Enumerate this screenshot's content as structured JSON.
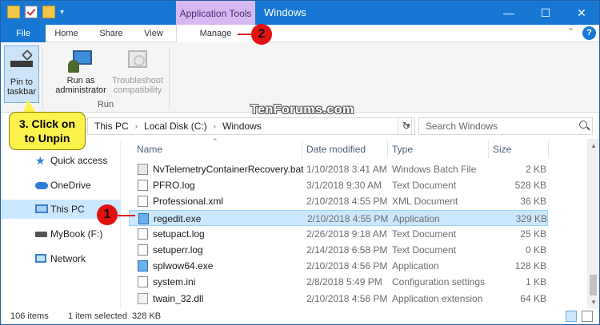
{
  "titlebar": {
    "context_tab": "Application Tools",
    "window_title": "Windows",
    "minimize": "—",
    "maximize": "☐",
    "close": "✕"
  },
  "ribbon_tabs": {
    "file": "File",
    "home": "Home",
    "share": "Share",
    "view": "View",
    "manage": "Manage"
  },
  "ribbon": {
    "pin_label_1": "Pin to",
    "pin_label_2": "taskbar",
    "admin_label_1": "Run as",
    "admin_label_2": "administrator",
    "trouble_label_1": "Troubleshoot",
    "trouble_label_2": "compatibility",
    "group_label": "Run"
  },
  "address": {
    "crumbs": [
      "This PC",
      "Local Disk (C:)",
      "Windows"
    ],
    "search_placeholder": "Search Windows"
  },
  "nav": [
    {
      "label": "Quick access",
      "icon": "star-icon"
    },
    {
      "label": "OneDrive",
      "icon": "cloud-icon"
    },
    {
      "label": "This PC",
      "icon": "computer-icon",
      "selected": true
    },
    {
      "label": "MyBook (F:)",
      "icon": "drive-icon"
    },
    {
      "label": "Network",
      "icon": "network-icon"
    }
  ],
  "columns": {
    "name": "Name",
    "date": "Date modified",
    "type": "Type",
    "size": "Size"
  },
  "files": [
    {
      "name": "NvTelemetryContainerRecovery.bat",
      "date": "1/10/2018 3:41 AM",
      "type": "Windows Batch File",
      "size": "2 KB",
      "icon": "bat"
    },
    {
      "name": "PFRO.log",
      "date": "3/1/2018 9:30 AM",
      "type": "Text Document",
      "size": "528 KB",
      "icon": "txt"
    },
    {
      "name": "Professional.xml",
      "date": "2/10/2018 4:55 PM",
      "type": "XML Document",
      "size": "36 KB",
      "icon": "txt"
    },
    {
      "name": "regedit.exe",
      "date": "2/10/2018 4:55 PM",
      "type": "Application",
      "size": "329 KB",
      "icon": "exe",
      "selected": true
    },
    {
      "name": "setupact.log",
      "date": "2/26/2018 9:18 AM",
      "type": "Text Document",
      "size": "25 KB",
      "icon": "txt"
    },
    {
      "name": "setuperr.log",
      "date": "2/14/2018 6:58 PM",
      "type": "Text Document",
      "size": "0 KB",
      "icon": "txt"
    },
    {
      "name": "splwow64.exe",
      "date": "2/10/2018 4:56 PM",
      "type": "Application",
      "size": "128 KB",
      "icon": "exe"
    },
    {
      "name": "system.ini",
      "date": "2/8/2018 5:49 PM",
      "type": "Configuration settings",
      "size": "1 KB",
      "icon": "txt"
    },
    {
      "name": "twain_32.dll",
      "date": "2/10/2018 4:56 PM",
      "type": "Application extension",
      "size": "64 KB",
      "icon": "dll"
    }
  ],
  "status": {
    "item_count": "106 items",
    "selection": "1 item selected",
    "selection_size": "328 KB"
  },
  "annotations": {
    "badge_1": "1",
    "badge_2": "2",
    "callout_line_1": "3. Click on",
    "callout_line_2": "to Unpin",
    "watermark": "TenForums.com"
  },
  "colors": {
    "accent": "#1778d4",
    "context_tab": "#d8b8f0",
    "selection": "#cce8ff",
    "badge": "#e11212",
    "callout": "#fbf24b"
  }
}
